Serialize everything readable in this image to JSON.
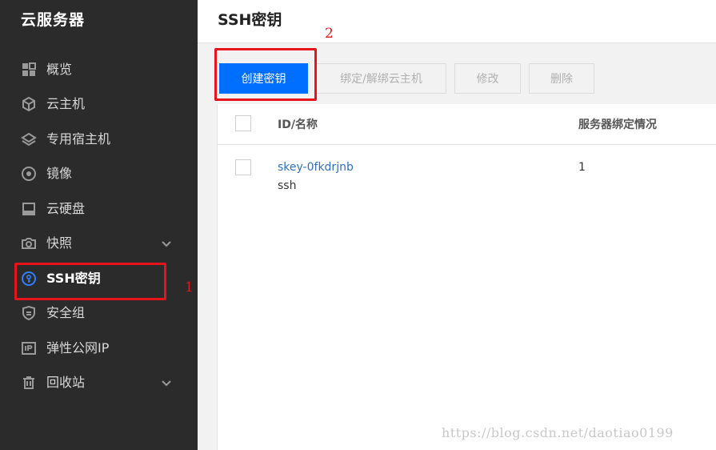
{
  "sidebar": {
    "title": "云服务器",
    "items": [
      {
        "label": "概览",
        "icon": "grid-icon"
      },
      {
        "label": "云主机",
        "icon": "cube-icon"
      },
      {
        "label": "专用宿主机",
        "icon": "layers-icon"
      },
      {
        "label": "镜像",
        "icon": "disc-icon"
      },
      {
        "label": "云硬盘",
        "icon": "disk-icon"
      },
      {
        "label": "快照",
        "icon": "camera-icon",
        "expandable": true
      },
      {
        "label": "SSH密钥",
        "icon": "key-icon",
        "active": true
      },
      {
        "label": "安全组",
        "icon": "shield-icon"
      },
      {
        "label": "弹性公网IP",
        "icon": "ip-icon"
      },
      {
        "label": "回收站",
        "icon": "trash-icon",
        "expandable": true
      }
    ]
  },
  "header": {
    "title": "SSH密钥"
  },
  "toolbar": {
    "create_label": "创建密钥",
    "bind_label": "绑定/解绑云主机",
    "edit_label": "修改",
    "delete_label": "删除"
  },
  "table": {
    "columns": [
      "ID/名称",
      "服务器绑定情况"
    ],
    "rows": [
      {
        "id": "skey-0fkdrjnb",
        "name": "ssh",
        "bind_count": "1"
      }
    ]
  },
  "annotations": {
    "one": "1",
    "two": "2"
  },
  "watermark": "https://blog.csdn.net/daotiao0199",
  "colors": {
    "sidebar_bg": "#2b2b2b",
    "primary": "#006eff",
    "annotation": "#e8141b",
    "link": "#2f6fbf"
  }
}
